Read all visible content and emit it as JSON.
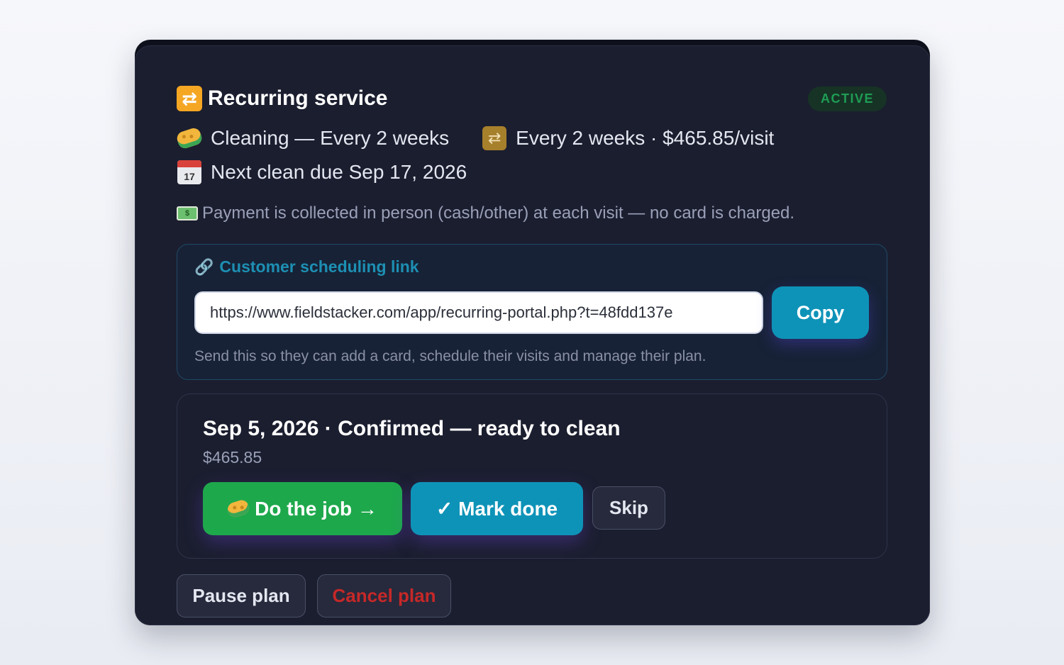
{
  "header": {
    "title_icon": "repeat-icon",
    "title": "Recurring service",
    "status_badge": "ACTIVE"
  },
  "service": {
    "service_icon": "sponge-icon",
    "service_label": "Cleaning — Every 2 weeks",
    "frequency_icon": "repeat-icon",
    "frequency_price": "Every 2 weeks · $465.85/visit",
    "calendar_icon": "calendar-icon",
    "next_due": "Next clean due Sep 17, 2026",
    "calendar_day": "17",
    "payment_icon": "cash-icon",
    "payment_note": "Payment is collected in person (cash/other) at each visit — no card is charged."
  },
  "scheduling_link": {
    "icon": "link-icon",
    "title": "Customer scheduling link",
    "url": "https://www.fieldstacker.com/app/recurring-portal.php?t=48fdd137e",
    "copy_label": "Copy",
    "help_text": "Send this so they can add a card, schedule their visits and manage their plan."
  },
  "visit": {
    "title": "Sep 5, 2026 · Confirmed — ready to clean",
    "price": "$465.85",
    "do_job_label": "Do the job →",
    "mark_done_label": "✓ Mark done",
    "skip_label": "Skip"
  },
  "plan_actions": {
    "pause_label": "Pause plan",
    "cancel_label": "Cancel plan"
  },
  "colors": {
    "card_bg": "#1b1e2f",
    "accent_teal": "#0e93b8",
    "accent_green": "#1ea84c",
    "status_green": "#1f9d55",
    "danger_red": "#c62828"
  }
}
